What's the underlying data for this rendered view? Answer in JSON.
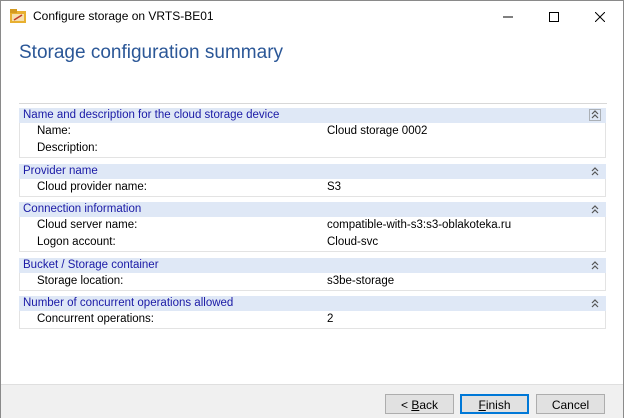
{
  "window": {
    "title": "Configure storage on VRTS-BE01",
    "minimize": "—",
    "maximize": "☐",
    "close": "✕"
  },
  "page": {
    "title": "Storage configuration summary"
  },
  "sections": [
    {
      "title": "Name and description for the cloud storage device",
      "rows": [
        {
          "label": "Name:",
          "value": "Cloud storage 0002"
        },
        {
          "label": "Description:",
          "value": ""
        }
      ]
    },
    {
      "title": "Provider name",
      "rows": [
        {
          "label": "Cloud provider name:",
          "value": "S3"
        }
      ]
    },
    {
      "title": "Connection information",
      "rows": [
        {
          "label": "Cloud server name:",
          "value": "compatible-with-s3:s3-oblakoteka.ru"
        },
        {
          "label": "Logon account:",
          "value": "Cloud-svc"
        }
      ]
    },
    {
      "title": "Bucket / Storage container",
      "rows": [
        {
          "label": "Storage location:",
          "value": "s3be-storage"
        }
      ]
    },
    {
      "title": "Number of concurrent operations allowed",
      "rows": [
        {
          "label": "Concurrent operations:",
          "value": "2"
        }
      ]
    }
  ],
  "buttons": {
    "back_prefix": "< ",
    "back_mnemonic": "B",
    "back_rest": "ack",
    "finish_mnemonic": "F",
    "finish_rest": "inish",
    "cancel": "Cancel"
  },
  "colors": {
    "title_blue": "#2b5797",
    "section_bg": "#dfe8f6",
    "section_text": "#1a1aa6"
  }
}
